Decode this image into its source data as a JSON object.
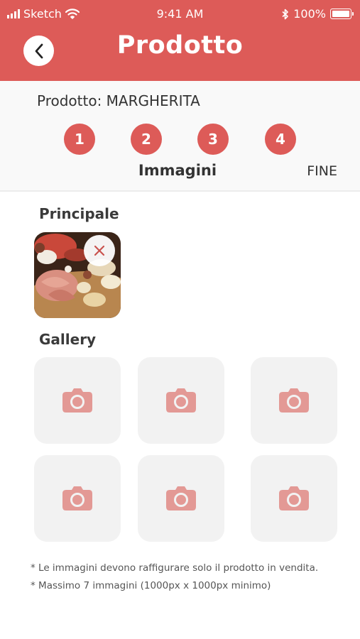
{
  "status": {
    "carrier": "Sketch",
    "time": "9:41 AM",
    "battery": "100%"
  },
  "header": {
    "title": "Prodotto",
    "back_icon": "chevron-left-icon"
  },
  "product": {
    "label": "Prodotto: MARGHERITA"
  },
  "steps": {
    "items": [
      "1",
      "2",
      "3",
      "4"
    ],
    "current_label": "Immagini",
    "end_label": "FINE"
  },
  "principal": {
    "title": "Principale",
    "image": "charcuterie-board-photo",
    "remove_icon": "close-icon"
  },
  "gallery": {
    "title": "Gallery",
    "slots": 6,
    "slot_icon": "camera-icon"
  },
  "notes": [
    "* Le immagini devono raffigurare solo il prodotto in vendita.",
    "* Massimo 7 immagini (1000px x 1000px minimo)"
  ],
  "colors": {
    "accent": "#dd5b58",
    "slot_bg": "#f2f2f2",
    "camera": "#e39995"
  }
}
